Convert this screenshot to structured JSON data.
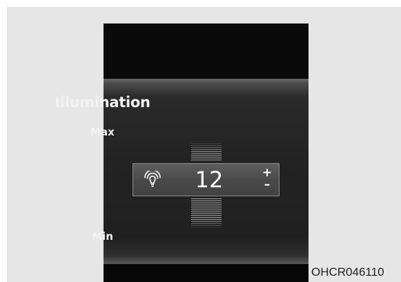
{
  "screen": {
    "title": "Illumination",
    "max_label": "Max",
    "min_label": "Min"
  },
  "selector": {
    "icon": "bulb-icon",
    "value": "12",
    "increase_label": "+",
    "decrease_label": "–",
    "level": 12
  },
  "caption": {
    "figure_code": "OHCR046110"
  },
  "colors": {
    "page_background": "#e6e6e6",
    "screen_background": "#0a0a0a",
    "menu_background": "#232323",
    "selector_background": "#4a4a4a",
    "text": "#f2f2f2"
  }
}
